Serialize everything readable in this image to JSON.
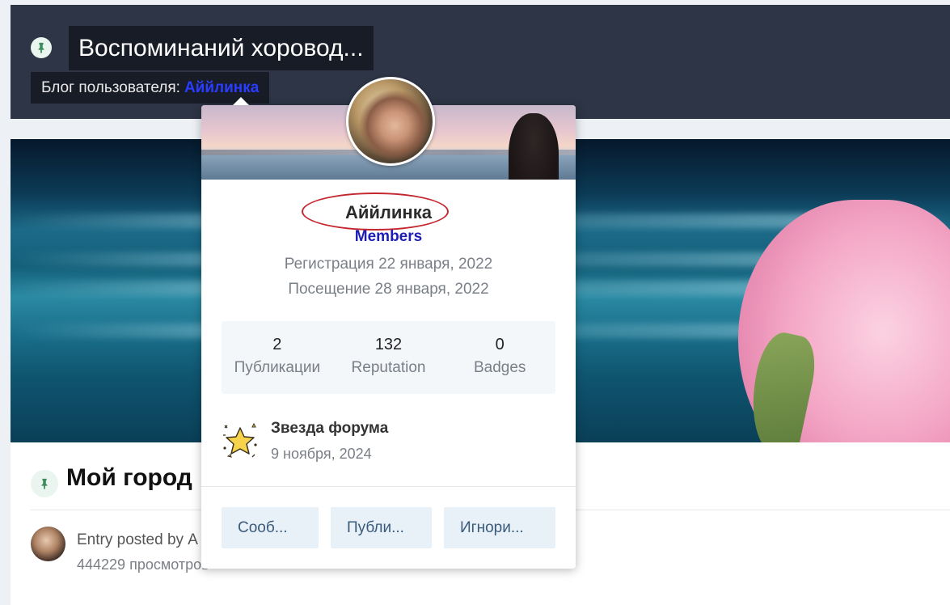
{
  "header": {
    "title": "Воспоминаний хоровод...",
    "subtitle_prefix": "Блог пользователя:",
    "author": "Аййлинка"
  },
  "entry": {
    "title": "Мой город",
    "posted_by": "Entry posted by А",
    "views": "444229 просмотров"
  },
  "hovercard": {
    "name": "Аййлинка",
    "group": "Members",
    "registered": "Регистрация 22 января, 2022",
    "last_visit": "Посещение 28 января, 2022",
    "stats": [
      {
        "value": "2",
        "label": "Публикации"
      },
      {
        "value": "132",
        "label": "Reputation"
      },
      {
        "value": "0",
        "label": "Badges"
      }
    ],
    "badge": {
      "title": "Звезда форума",
      "date": "9 ноября, 2024",
      "icon": "star-icon"
    },
    "buttons": {
      "message": "Сооб...",
      "content": "Публи...",
      "ignore": "Игнори..."
    }
  },
  "colors": {
    "header_bg": "#2d3546",
    "author_link": "#2a3cff",
    "group_color": "#1d1db8",
    "annotation": "#c4262e",
    "button_bg": "#e9f1f8"
  }
}
